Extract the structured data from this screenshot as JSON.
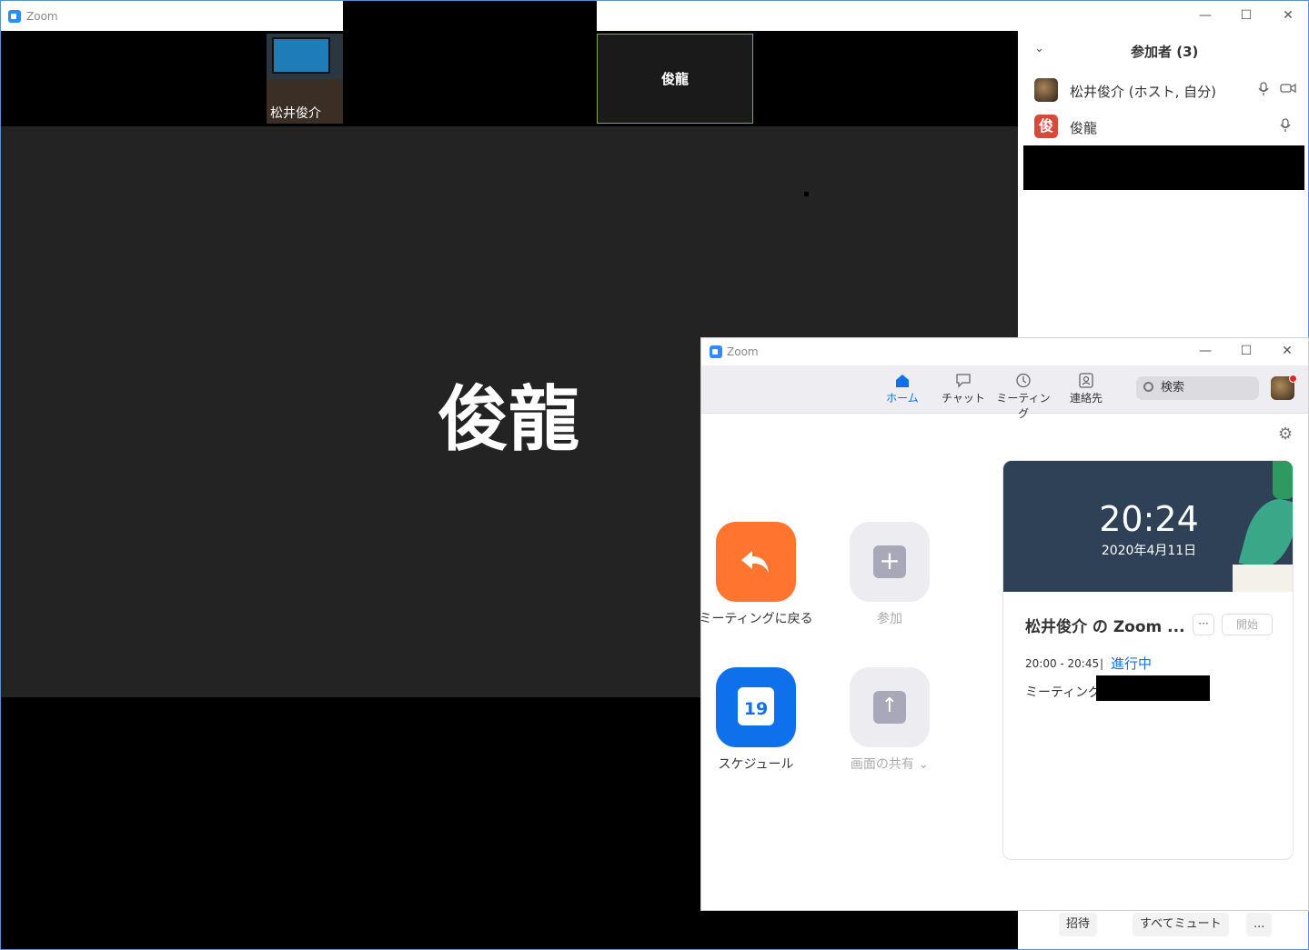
{
  "meeting_window": {
    "title": "Zoom",
    "thumbnails": {
      "self_name": "松井俊介",
      "other_name": "俊龍"
    },
    "active_speaker_name": "俊龍"
  },
  "participants_panel": {
    "title": "参加者 (3)",
    "rows": [
      {
        "name": "松井俊介 (ホスト, 自分)",
        "avatar_char": "",
        "avatar_color": "#6a4a2a"
      },
      {
        "name": "俊龍",
        "avatar_char": "俊",
        "avatar_color": "#d64a3a"
      }
    ],
    "buttons": {
      "invite": "招待",
      "mute_all": "すべてミュート",
      "more": "..."
    }
  },
  "home_window": {
    "title": "Zoom",
    "nav": {
      "home": "ホーム",
      "chat": "チャット",
      "meetings": "ミーティング",
      "contacts": "連絡先"
    },
    "search_placeholder": "検索",
    "actions": {
      "return": "ミーティングに戻る",
      "join": "参加",
      "schedule": "スケジュール",
      "schedule_day": "19",
      "share": "画面の共有"
    },
    "card": {
      "time": "20:24",
      "date": "2020年4月11日",
      "meeting_title": "松井俊介 の Zoom ...",
      "more": "···",
      "start": "開始",
      "time_range": "20:00 - 20:45",
      "separator": "|",
      "status": "進行中",
      "meeting_id_label": "ミーティング ID"
    }
  },
  "colors": {
    "accent_blue": "#0e71eb",
    "orange": "#ff742e"
  }
}
